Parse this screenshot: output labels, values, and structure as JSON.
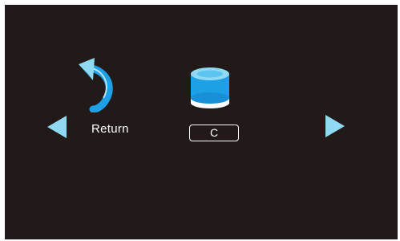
{
  "screen": {
    "background_color": "#211a18",
    "accent_color": "#8fdaf2",
    "icon_blue": "#1ea0e6"
  },
  "nav": {
    "left_icon": "triangle-left-icon",
    "right_icon": "triangle-right-icon"
  },
  "items": [
    {
      "icon": "return-arrow-icon",
      "label": "Return"
    },
    {
      "icon": "drive-disk-icon",
      "label": "C"
    }
  ]
}
